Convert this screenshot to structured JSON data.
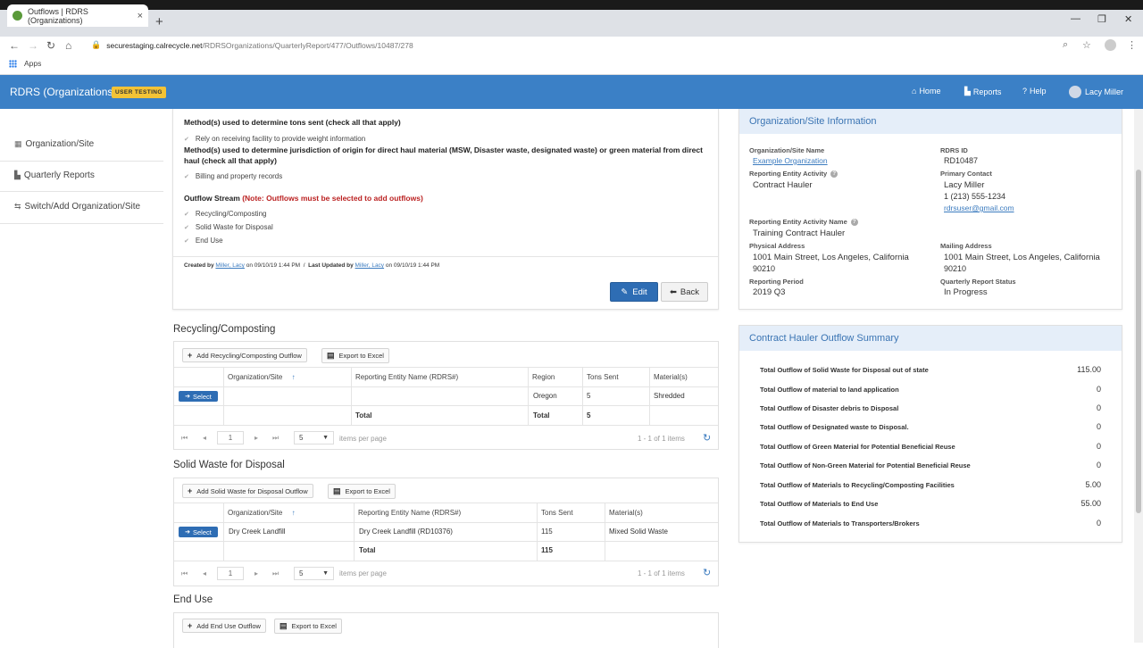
{
  "browser": {
    "tab_title": "Outflows | RDRS (Organizations)",
    "tab_close": "×",
    "new_tab": "+",
    "url_host": "securestaging.calrecycle.net",
    "url_path": "/RDRSOrganizations/QuarterlyReport/477/Outflows/10487/278",
    "bookmarks_apps": "Apps",
    "win_min": "—",
    "win_max": "❐",
    "win_close": "✕"
  },
  "appbar": {
    "brand": "RDRS (Organizations)",
    "badge": "USER TESTING",
    "home": "Home",
    "reports": "Reports",
    "help": "Help",
    "user": "Lacy Miller"
  },
  "sidebar": {
    "items": [
      {
        "label": "Organization/Site"
      },
      {
        "label": "Quarterly Reports"
      },
      {
        "label": "Switch/Add Organization/Site"
      }
    ]
  },
  "details": {
    "methods_tons_title": "Method(s) used to determine tons sent (check all that apply)",
    "methods_tons_item": "Rely on receiving facility to provide weight information",
    "methods_juris_title": "Method(s) used to determine jurisdiction of origin for direct haul material (MSW, Disaster waste, designated waste) or green material from direct haul (check all that apply)",
    "methods_juris_item": "Billing and property records",
    "outflow_stream_title": "Outflow Stream",
    "outflow_stream_note": "(Note: Outflows must be selected to add outflows)",
    "streams": [
      "Recycling/Composting",
      "Solid Waste for Disposal",
      "End Use"
    ],
    "created_by_label": "Created by",
    "created_by_user": "Miller, Lacy",
    "created_on": "on 09/10/19 1:44 PM",
    "sep": "/",
    "updated_by_label": "Last Updated by",
    "updated_by_user": "Miller, Lacy",
    "updated_on": "on 09/10/19 1:44 PM",
    "edit": "Edit",
    "back": "Back"
  },
  "recycling": {
    "title": "Recycling/Composting",
    "add_btn": "Add Recycling/Composting Outflow",
    "export_btn": "Export to Excel",
    "columns": [
      "Organization/Site",
      "Reporting Entity Name (RDRS#)",
      "Region",
      "Tons Sent",
      "Material(s)"
    ],
    "sort_arrow": "↑",
    "row": {
      "select": "Select",
      "org": "",
      "entity": "",
      "region": "Oregon",
      "tons": "5",
      "material": "Shredded"
    },
    "total_label": "Total",
    "total_label2": "Total",
    "total_value": "5",
    "page": "1",
    "page_size": "5",
    "items_per_page": "items per page",
    "range": "1 - 1 of 1 items"
  },
  "solidwaste": {
    "title": "Solid Waste for Disposal",
    "add_btn": "Add Solid Waste for Disposal Outflow",
    "export_btn": "Export to Excel",
    "columns": [
      "Organization/Site",
      "Reporting Entity Name (RDRS#)",
      "Tons Sent",
      "Material(s)"
    ],
    "sort_arrow": "↑",
    "row": {
      "select": "Select",
      "org": "Dry Creek Landfill",
      "entity": "Dry Creek Landfill (RD10376)",
      "tons": "115",
      "material": "Mixed Solid Waste"
    },
    "total_label": "Total",
    "total_value": "115",
    "page": "1",
    "page_size": "5",
    "items_per_page": "items per page",
    "range": "1 - 1 of 1 items"
  },
  "enduse": {
    "title": "End Use",
    "add_btn": "Add End Use Outflow",
    "export_btn": "Export to Excel"
  },
  "orginfo": {
    "title": "Organization/Site Information",
    "site_name_label": "Organization/Site Name",
    "site_name": "Example Organization",
    "rdrs_id_label": "RDRS ID",
    "rdrs_id": "RD10487",
    "activity_label": "Reporting Entity Activity",
    "activity": "Contract Hauler",
    "primary_contact_label": "Primary Contact",
    "primary_contact_name": "Lacy Miller",
    "primary_contact_phone": "1 (213) 555-1234",
    "primary_contact_email": "rdrsuser@gmail.com",
    "activity_name_label": "Reporting Entity Activity Name",
    "activity_name": "Training Contract Hauler",
    "physical_label": "Physical Address",
    "physical_line1": "1001 Main Street, Los Angeles, California",
    "physical_line2": "90210",
    "mailing_label": "Mailing Address",
    "mailing_line1": "1001 Main Street, Los Angeles, California",
    "mailing_line2": "90210",
    "period_label": "Reporting Period",
    "period": "2019 Q3",
    "status_label": "Quarterly Report Status",
    "status": "In Progress"
  },
  "summary": {
    "title": "Contract Hauler Outflow Summary",
    "rows": [
      {
        "label": "Total Outflow of Solid Waste for Disposal out of state",
        "value": "115.00"
      },
      {
        "label": "Total Outflow of material to land application",
        "value": "0"
      },
      {
        "label": "Total Outflow of Disaster debris to Disposal",
        "value": "0"
      },
      {
        "label": "Total Outflow of Designated waste to Disposal.",
        "value": "0"
      },
      {
        "label": "Total Outflow of Green Material for Potential Beneficial Reuse",
        "value": "0"
      },
      {
        "label": "Total Outflow of Non-Green Material for Potential Beneficial Reuse",
        "value": "0"
      },
      {
        "label": "Total Outflow of Materials to Recycling/Composting Facilities",
        "value": "5.00"
      },
      {
        "label": "Total Outflow of Materials to End Use",
        "value": "55.00"
      },
      {
        "label": "Total Outflow of Materials to Transporters/Brokers",
        "value": "0"
      }
    ]
  }
}
